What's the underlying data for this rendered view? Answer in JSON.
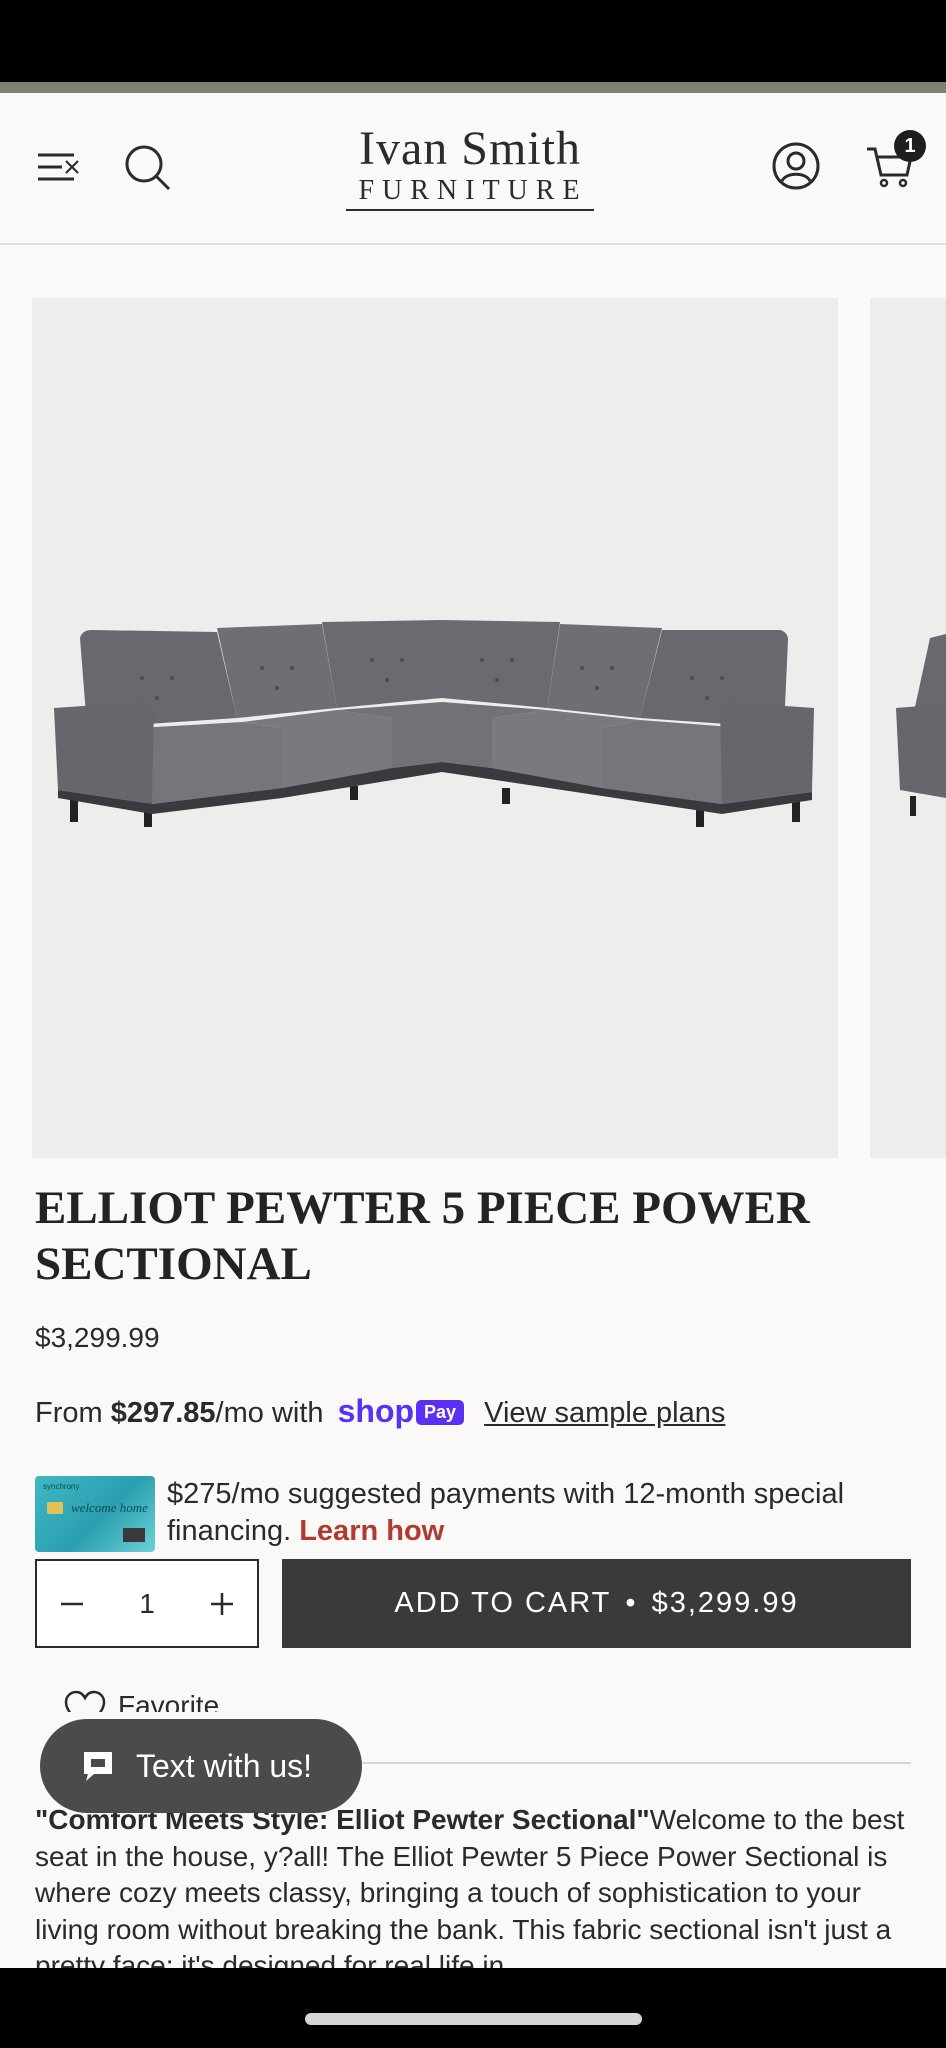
{
  "header": {
    "logo_top": "Ivan Smith",
    "logo_bottom": "FURNITURE",
    "cart_count": "1",
    "icons": [
      "menu-icon",
      "search-icon",
      "account-icon",
      "cart-icon"
    ]
  },
  "product": {
    "title": "ELLIOT PEWTER 5 PIECE POWER SECTIONAL",
    "price": "$3,299.99",
    "installments": {
      "prefix": "From ",
      "amount": "$297.85",
      "suffix": "/mo with",
      "shop": "shop",
      "pay": "Pay",
      "link": "View sample plans"
    },
    "financing": {
      "text": "$275/mo suggested payments with 12-month special financing.",
      "link": "Learn how",
      "card_brand": "synchrony",
      "card_script": "welcome home"
    },
    "quantity": "1",
    "add_to_cart_label": "ADD TO CART",
    "add_to_cart_price": "$3,299.99",
    "favorite_label": "Favorite"
  },
  "chat_widget": {
    "label": "Text with us!"
  },
  "description": {
    "heading": "\"Comfort Meets Style: Elliot Pewter Sectional\"",
    "body": "Welcome to the best seat in the house, y?all! The Elliot Pewter 5 Piece Power Sectional is where cozy meets classy, bringing a touch of sophistication to your living room without breaking the bank. This fabric sectional isn't just a pretty face; it's designed for real life in"
  },
  "colors": {
    "accent_bar": "#7b8270",
    "button_dark": "#3a3a3c",
    "shop_pay": "#5a31f4",
    "learn_link": "#b03a2e"
  }
}
